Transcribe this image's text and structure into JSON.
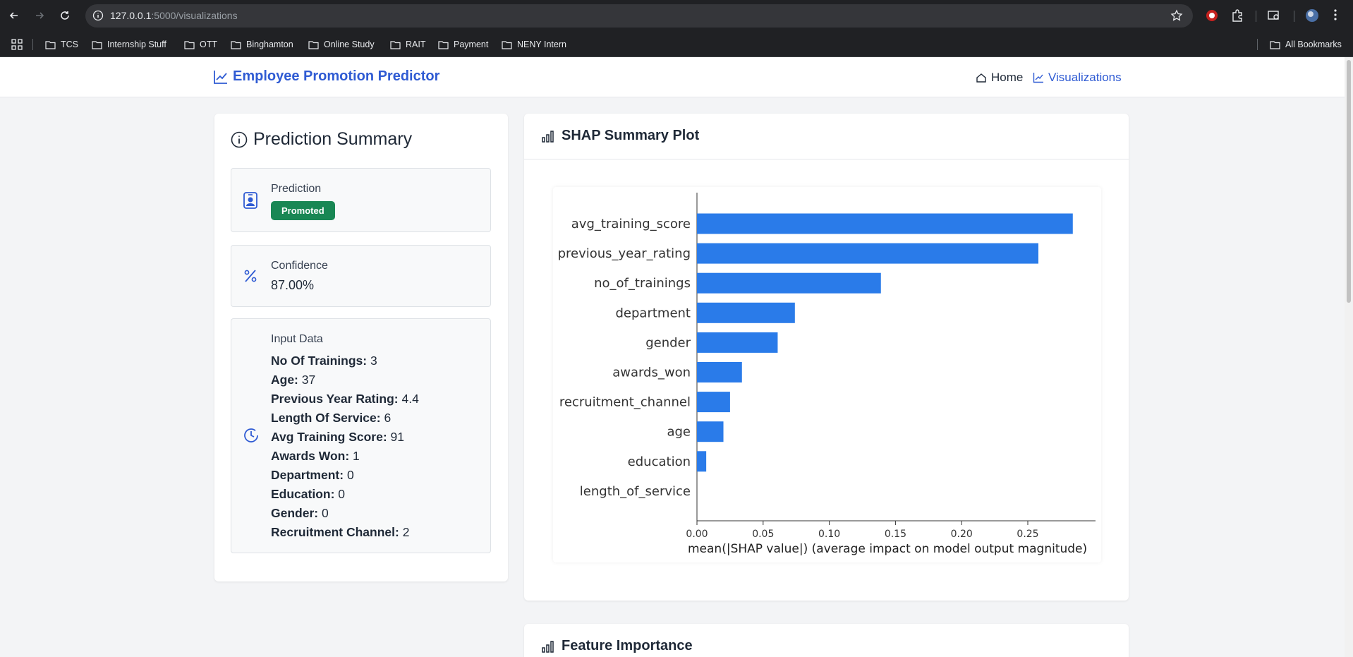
{
  "browser": {
    "url_host": "127.0.0.1",
    "url_rest": ":5000/visualizations",
    "bookmarks": [
      "TCS",
      "Internship Stuff",
      "OTT",
      "Binghamton",
      "Online Study",
      "RAIT",
      "Payment",
      "NENY Intern"
    ],
    "all_bookmarks": "All Bookmarks"
  },
  "header": {
    "brand": "Employee Promotion Predictor",
    "nav_home": "Home",
    "nav_visualizations": "Visualizations"
  },
  "summary": {
    "title": "Prediction Summary",
    "prediction_label": "Prediction",
    "prediction_value": "Promoted",
    "confidence_label": "Confidence",
    "confidence_value": "87.00%",
    "input_label": "Input Data",
    "inputs": [
      {
        "key": "No Of Trainings:",
        "value": "3"
      },
      {
        "key": "Age:",
        "value": "37"
      },
      {
        "key": "Previous Year Rating:",
        "value": "4.4"
      },
      {
        "key": "Length Of Service:",
        "value": "6"
      },
      {
        "key": "Avg Training Score:",
        "value": "91"
      },
      {
        "key": "Awards Won:",
        "value": "1"
      },
      {
        "key": "Department:",
        "value": "0"
      },
      {
        "key": "Education:",
        "value": "0"
      },
      {
        "key": "Gender:",
        "value": "0"
      },
      {
        "key": "Recruitment Channel:",
        "value": "2"
      }
    ]
  },
  "shap": {
    "title": "SHAP Summary Plot"
  },
  "feature_importance": {
    "title": "Feature Importance"
  },
  "colors": {
    "brand": "#2f5bd3",
    "badge": "#198754",
    "bar": "#2a7be9"
  },
  "chart_data": {
    "type": "bar",
    "orientation": "horizontal",
    "categories": [
      "avg_training_score",
      "previous_year_rating",
      "no_of_trainings",
      "department",
      "gender",
      "awards_won",
      "recruitment_channel",
      "age",
      "education",
      "length_of_service"
    ],
    "values": [
      0.284,
      0.258,
      0.139,
      0.074,
      0.061,
      0.034,
      0.025,
      0.02,
      0.007,
      0.0
    ],
    "xlabel": "mean(|SHAP value|) (average impact on model output magnitude)",
    "xticks": [
      "0.00",
      "0.05",
      "0.10",
      "0.15",
      "0.20",
      "0.25"
    ],
    "xlim": [
      0,
      0.3
    ],
    "grid": false
  }
}
